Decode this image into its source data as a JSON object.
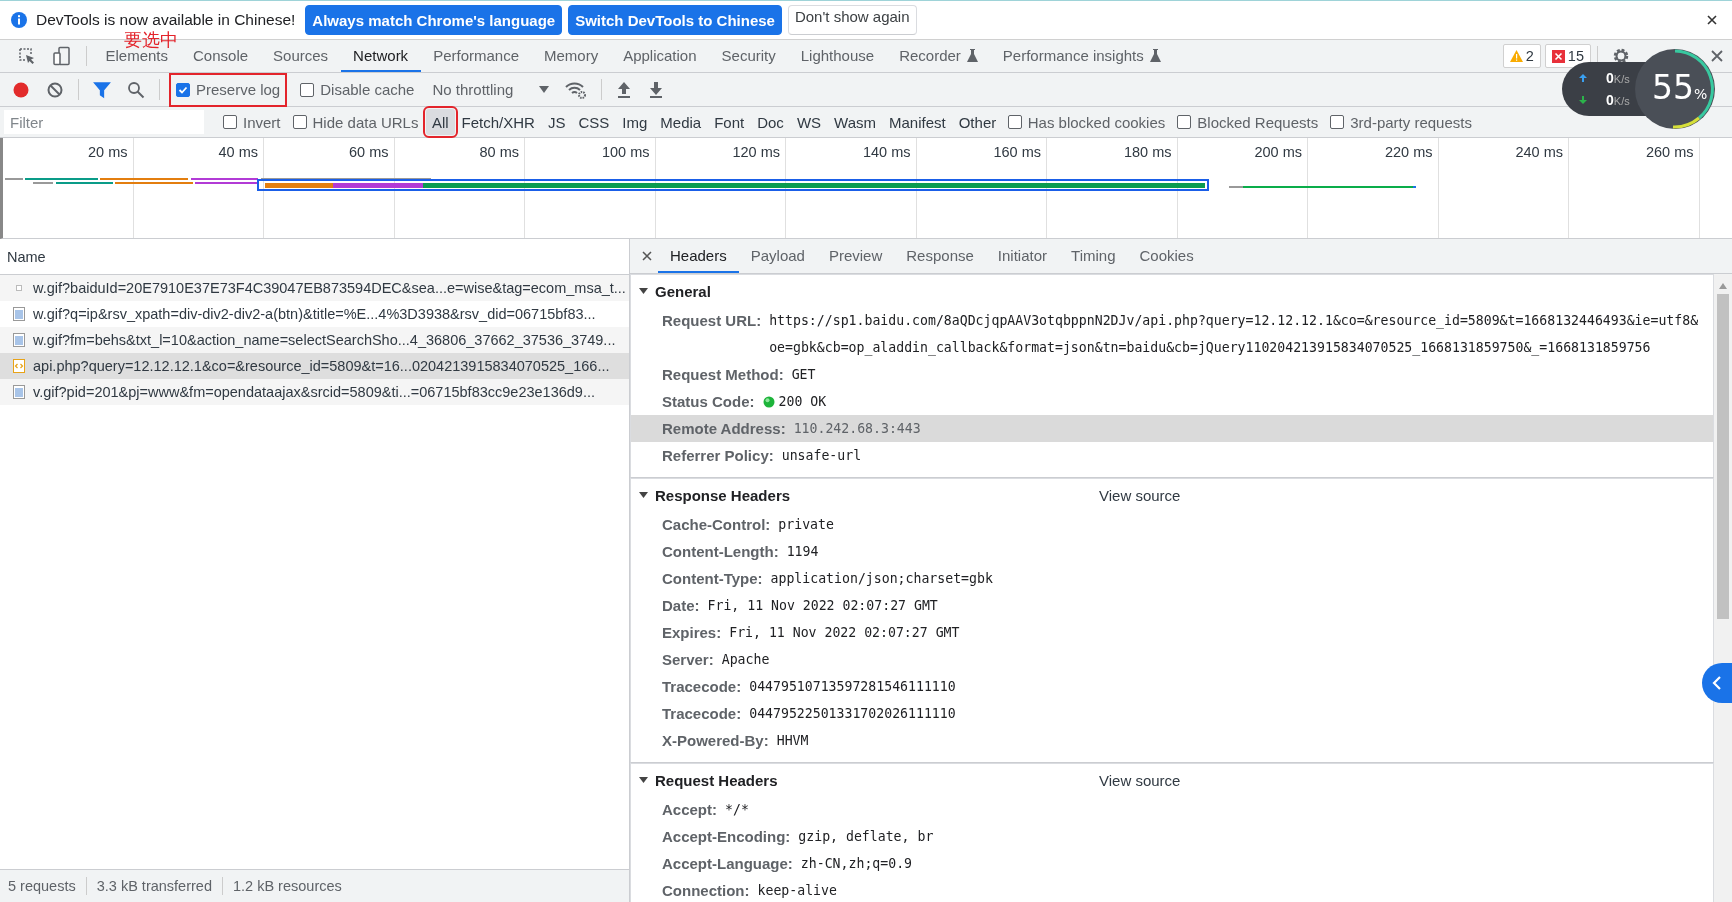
{
  "infobar": {
    "message": "DevTools is now available in Chinese!",
    "buttons": [
      {
        "label": "Always match Chrome's language",
        "kind": "primary"
      },
      {
        "label": "Switch DevTools to Chinese",
        "kind": "primary"
      },
      {
        "label": "Don't show again",
        "kind": "secondary"
      }
    ]
  },
  "annotation": "要选中",
  "tabs": [
    {
      "label": "Elements",
      "selected": false,
      "experimental": false
    },
    {
      "label": "Console",
      "selected": false,
      "experimental": false
    },
    {
      "label": "Sources",
      "selected": false,
      "experimental": false
    },
    {
      "label": "Network",
      "selected": true,
      "experimental": false
    },
    {
      "label": "Performance",
      "selected": false,
      "experimental": false
    },
    {
      "label": "Memory",
      "selected": false,
      "experimental": false
    },
    {
      "label": "Application",
      "selected": false,
      "experimental": false
    },
    {
      "label": "Security",
      "selected": false,
      "experimental": false
    },
    {
      "label": "Lighthouse",
      "selected": false,
      "experimental": false
    },
    {
      "label": "Recorder",
      "selected": false,
      "experimental": true
    },
    {
      "label": "Performance insights",
      "selected": false,
      "experimental": true
    }
  ],
  "issues": {
    "warnings": "2",
    "errors": "15"
  },
  "toolbar": {
    "recording": true,
    "filter_active": true,
    "preserve_log": {
      "label": "Preserve log",
      "checked": true,
      "annotated": true
    },
    "disable_cache": {
      "label": "Disable cache",
      "checked": false,
      "annotated": false
    },
    "throttling": "No throttling"
  },
  "filter": {
    "placeholder": "Filter",
    "options": [
      {
        "label": "Invert",
        "checked": false
      },
      {
        "label": "Hide data URLs",
        "checked": false
      }
    ],
    "types": [
      {
        "label": "All",
        "selected": true,
        "annotated": true
      },
      {
        "label": "Fetch/XHR",
        "selected": false,
        "annotated": false
      },
      {
        "label": "JS",
        "selected": false,
        "annotated": false
      },
      {
        "label": "CSS",
        "selected": false,
        "annotated": false
      },
      {
        "label": "Img",
        "selected": false,
        "annotated": false
      },
      {
        "label": "Media",
        "selected": false,
        "annotated": false
      },
      {
        "label": "Font",
        "selected": false,
        "annotated": false
      },
      {
        "label": "Doc",
        "selected": false,
        "annotated": false
      },
      {
        "label": "WS",
        "selected": false,
        "annotated": false
      },
      {
        "label": "Wasm",
        "selected": false,
        "annotated": false
      },
      {
        "label": "Manifest",
        "selected": false,
        "annotated": false
      },
      {
        "label": "Other",
        "selected": false,
        "annotated": false
      }
    ],
    "extra_options": [
      {
        "label": "Has blocked cookies",
        "checked": false
      },
      {
        "label": "Blocked Requests",
        "checked": false
      },
      {
        "label": "3rd-party requests",
        "checked": false
      }
    ]
  },
  "timeline": {
    "ticks": [
      "20 ms",
      "40 ms",
      "60 ms",
      "80 ms",
      "100 ms",
      "120 ms",
      "140 ms",
      "160 ms",
      "180 ms",
      "200 ms",
      "220 ms",
      "240 ms",
      "260 ms"
    ]
  },
  "requests": {
    "column": "Name",
    "rows": [
      {
        "name": "w.gif?baiduId=20E7910E37E73F4C39047EB873594DEC&sea...e=wise&tag=ecom_msa_t...",
        "kind": "blank",
        "selected": false
      },
      {
        "name": "w.gif?q=ip&rsv_xpath=div-div2-div2-a(btn)&title=%E...4%3D3938&rsv_did=06715bf83...",
        "kind": "image",
        "selected": false
      },
      {
        "name": "w.gif?fm=behs&txt_l=10&action_name=selectSearchSho...4_36806_37662_37536_3749...",
        "kind": "image",
        "selected": false
      },
      {
        "name": "api.php?query=12.12.12.1&co=&resource_id=5809&t=16...0204213915834070525_166...",
        "kind": "script",
        "selected": true
      },
      {
        "name": "v.gif?pid=201&pj=www&fm=opendataajax&srcid=5809&ti...=06715bf83cc9e23e136d9...",
        "kind": "image",
        "selected": false
      }
    ]
  },
  "status_bar": [
    "5 requests",
    "3.3 kB transferred",
    "1.2 kB resources"
  ],
  "detail_tabs": [
    {
      "label": "Headers",
      "selected": true
    },
    {
      "label": "Payload",
      "selected": false
    },
    {
      "label": "Preview",
      "selected": false
    },
    {
      "label": "Response",
      "selected": false
    },
    {
      "label": "Initiator",
      "selected": false
    },
    {
      "label": "Timing",
      "selected": false
    },
    {
      "label": "Cookies",
      "selected": false
    }
  ],
  "sections": [
    {
      "title": "General",
      "expanded": true,
      "rows": [
        {
          "name": "Request URL:",
          "value": "https://sp1.baidu.com/8aQDcjqpAAV3otqbppnN2DJv/api.php?query=12.12.12.1&co=&resource_id=5809&t=1668132446493&ie=utf8&oe=gbk&cb=op_aladdin_callback&format=json&tn=baidu&cb=jQuery110204213915834070525_1668131859750&_=1668131859756",
          "kind": "text",
          "highlighted": false
        },
        {
          "name": "Request Method:",
          "value": "GET",
          "kind": "text",
          "highlighted": false
        },
        {
          "name": "Status Code:",
          "value": "200 OK",
          "kind": "status",
          "highlighted": false
        },
        {
          "name": "Remote Address:",
          "value": "110.242.68.3:443",
          "kind": "text",
          "highlighted": true
        },
        {
          "name": "Referrer Policy:",
          "value": "unsafe-url",
          "kind": "text",
          "highlighted": false
        }
      ]
    },
    {
      "title": "Response Headers",
      "expanded": true,
      "view_source": "View source",
      "rows": [
        {
          "name": "Cache-Control:",
          "value": "private",
          "kind": "text",
          "highlighted": false
        },
        {
          "name": "Content-Length:",
          "value": "1194",
          "kind": "text",
          "highlighted": false
        },
        {
          "name": "Content-Type:",
          "value": "application/json;charset=gbk",
          "kind": "text",
          "highlighted": false
        },
        {
          "name": "Date:",
          "value": "Fri, 11 Nov 2022 02:07:27 GMT",
          "kind": "text",
          "highlighted": false
        },
        {
          "name": "Expires:",
          "value": "Fri, 11 Nov 2022 02:07:27 GMT",
          "kind": "text",
          "highlighted": false
        },
        {
          "name": "Server:",
          "value": "Apache",
          "kind": "text",
          "highlighted": false
        },
        {
          "name": "Tracecode:",
          "value": "04479510713597281546111110",
          "kind": "text",
          "highlighted": false
        },
        {
          "name": "Tracecode:",
          "value": "04479522501331702026111110",
          "kind": "text",
          "highlighted": false
        },
        {
          "name": "X-Powered-By:",
          "value": "HHVM",
          "kind": "text",
          "highlighted": false
        }
      ]
    },
    {
      "title": "Request Headers",
      "expanded": true,
      "view_source": "View source",
      "rows": [
        {
          "name": "Accept:",
          "value": "*/*",
          "kind": "text",
          "highlighted": false
        },
        {
          "name": "Accept-Encoding:",
          "value": "gzip, deflate, br",
          "kind": "text",
          "highlighted": false
        },
        {
          "name": "Accept-Language:",
          "value": "zh-CN,zh;q=0.9",
          "kind": "text",
          "highlighted": false
        },
        {
          "name": "Connection:",
          "value": "keep-alive",
          "kind": "text",
          "highlighted": false
        }
      ]
    }
  ],
  "speed_widget": {
    "upload": "0",
    "upload_unit": "K/s",
    "download": "0",
    "download_unit": "K/s",
    "percent": "55",
    "percent_sign": "%"
  }
}
